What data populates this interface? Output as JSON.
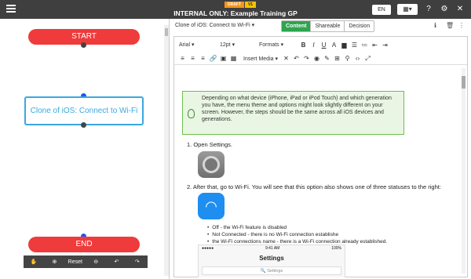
{
  "topbar": {
    "badge_draft": "DRAFT",
    "badge_version": "V1",
    "title": "INTERNAL ONLY: Example Training GP",
    "language": "EN"
  },
  "canvas": {
    "start_label": "START",
    "task_label": "Clone of iOS: Connect to Wi-Fi",
    "end_label": "END",
    "toolbar": {
      "reset_label": "Reset"
    }
  },
  "step": {
    "title": "Clone of iOS: Connect to Wi-Fi",
    "tabs": [
      "Content",
      "Shareable",
      "Decision"
    ]
  },
  "editor": {
    "font": "Arial",
    "size": "12pt",
    "formats": "Formats",
    "insert_media": "Insert Media",
    "note": "Depending on what device (iPhone, iPad or iPod Touch) and which generation you have, the menu theme and options might look slightly different on your screen. However, the steps should be the same across all iOS devices and generations.",
    "step1": "1. Open Settings.",
    "step2": "2. After that, go to Wi-Fi. You will see that this option also shows one of three statuses to the right:",
    "bullets": [
      "Off - the Wi-Fi feature is disabled",
      "Not Connected - there is no Wi-Fi connection establishe",
      "the Wi-Fi connections name - there is a Wi-Fi connection already established."
    ],
    "phone": {
      "carrier": "●●●●●",
      "time": "9:41 AM",
      "battery": "100%",
      "title": "Settings",
      "search": "Settings"
    }
  }
}
